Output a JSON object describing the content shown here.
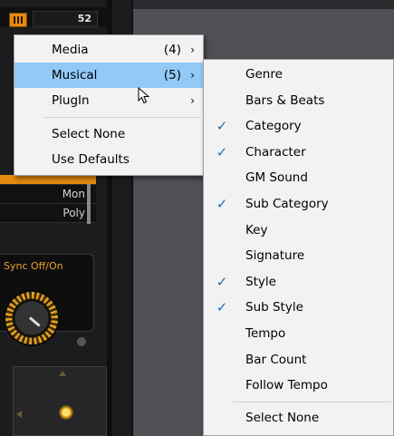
{
  "plugin_panel": {
    "counter_value": "52",
    "modes": [
      "Mon",
      "Poly"
    ],
    "sync_label": "Sync Off/On"
  },
  "main_menu": {
    "items": [
      {
        "label": "Media",
        "count": "(4)",
        "has_submenu": true
      },
      {
        "label": "Musical",
        "count": "(5)",
        "has_submenu": true
      },
      {
        "label": "PlugIn",
        "count": "",
        "has_submenu": true
      }
    ],
    "actions": [
      {
        "label": "Select None"
      },
      {
        "label": "Use Defaults"
      }
    ],
    "highlighted": "Musical",
    "submenu_arrow": "›"
  },
  "musical_submenu": {
    "items": [
      {
        "label": "Genre",
        "checked": false
      },
      {
        "label": "Bars & Beats",
        "checked": false
      },
      {
        "label": "Category",
        "checked": true
      },
      {
        "label": "Character",
        "checked": true
      },
      {
        "label": "GM Sound",
        "checked": false
      },
      {
        "label": "Sub Category",
        "checked": true
      },
      {
        "label": "Key",
        "checked": false
      },
      {
        "label": "Signature",
        "checked": false
      },
      {
        "label": "Style",
        "checked": true
      },
      {
        "label": "Sub Style",
        "checked": true
      },
      {
        "label": "Tempo",
        "checked": false
      },
      {
        "label": "Bar Count",
        "checked": false
      },
      {
        "label": "Follow Tempo",
        "checked": false
      }
    ],
    "actions": [
      {
        "label": "Select None"
      }
    ],
    "check_glyph": "✓"
  },
  "colors": {
    "accent_orange": "#e58a10",
    "menu_highlight": "#91c9f7",
    "menu_bg": "#f2f2f2",
    "check_blue": "#1f6fb5"
  },
  "icons": {
    "menu_button": "menu-bars-icon",
    "submenu": "chevron-right-icon",
    "check": "checkmark-icon",
    "pointer": "mouse-pointer-icon",
    "knob": "rotary-knob-icon"
  }
}
